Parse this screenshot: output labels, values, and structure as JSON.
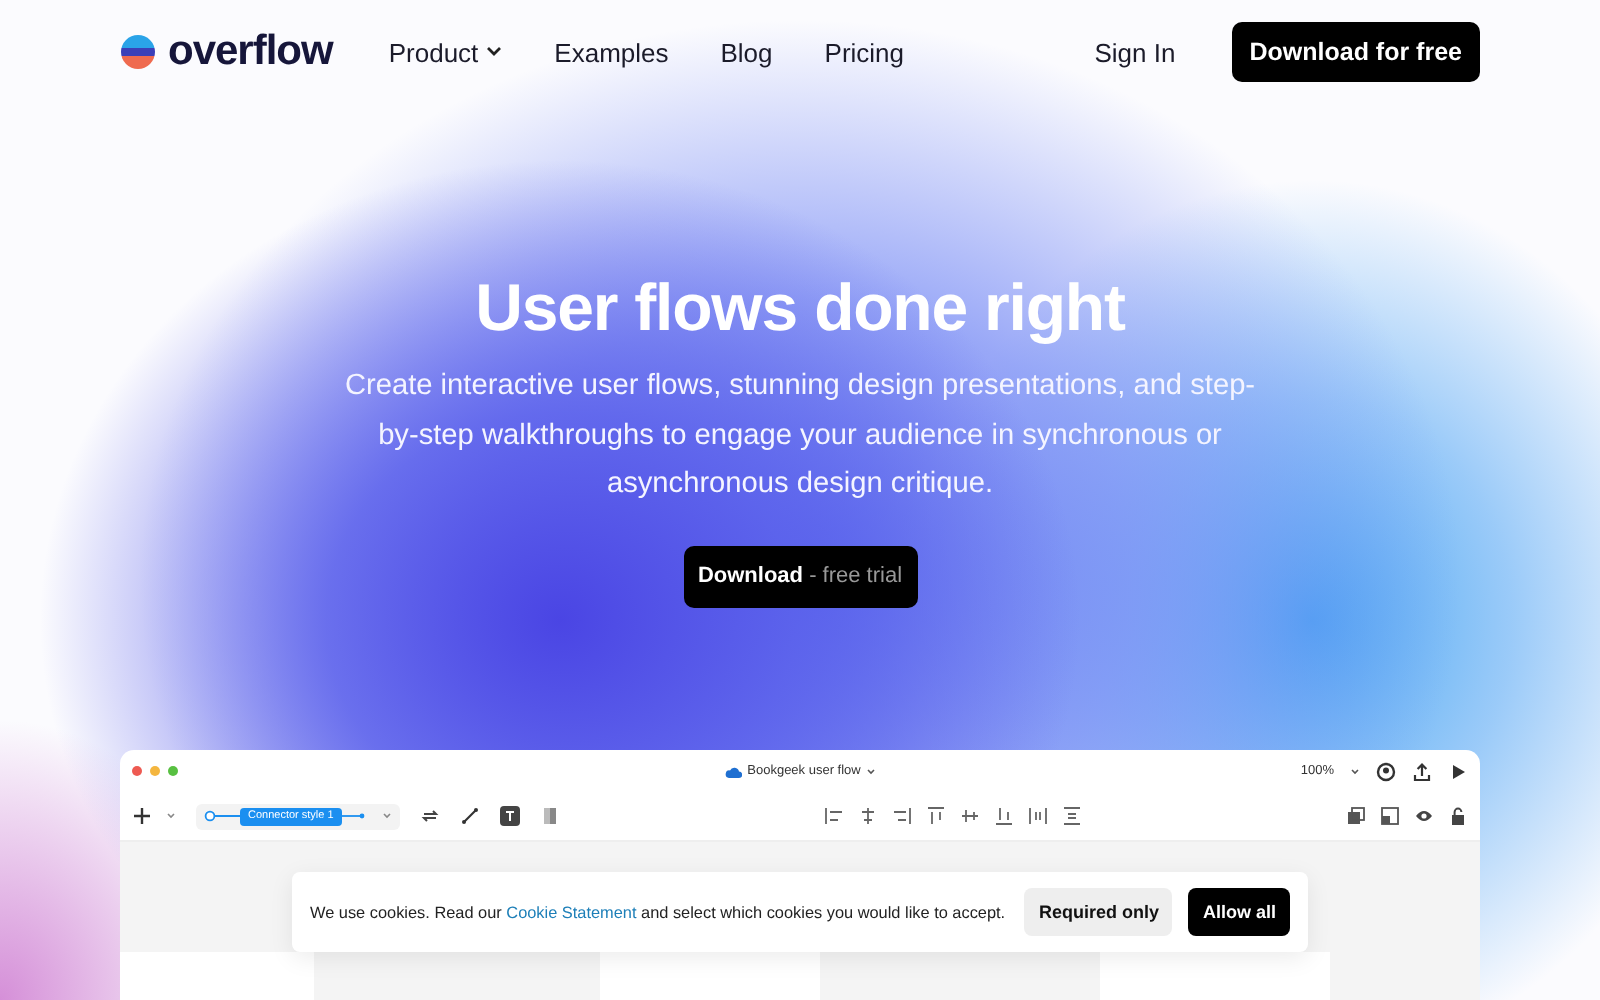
{
  "nav": {
    "brand": "overflow",
    "links": [
      {
        "label": "Product",
        "dropdown": true
      },
      {
        "label": "Examples",
        "dropdown": false
      },
      {
        "label": "Blog",
        "dropdown": false
      },
      {
        "label": "Pricing",
        "dropdown": false
      }
    ],
    "sign_in": "Sign In",
    "cta": "Download for free"
  },
  "hero": {
    "title": "User flows done right",
    "subtitle": "Create interactive user flows, stunning design presentations, and step-by-step walkthroughs to engage your audience in synchronous or asynchronous design critique.",
    "button": {
      "label": "Download",
      "suffix": "- free trial"
    }
  },
  "app_window": {
    "document_title": "Bookgeek user flow",
    "zoom": "100%",
    "connector_label": "Connector style 1"
  },
  "cookie_banner": {
    "text_before": "We use cookies. Read our ",
    "link": "Cookie Statement",
    "text_after": " and select which cookies you would like to accept.",
    "buttons": [
      {
        "label": "Required only",
        "kind": "secondary"
      },
      {
        "label": "Allow all",
        "kind": "primary"
      }
    ]
  }
}
